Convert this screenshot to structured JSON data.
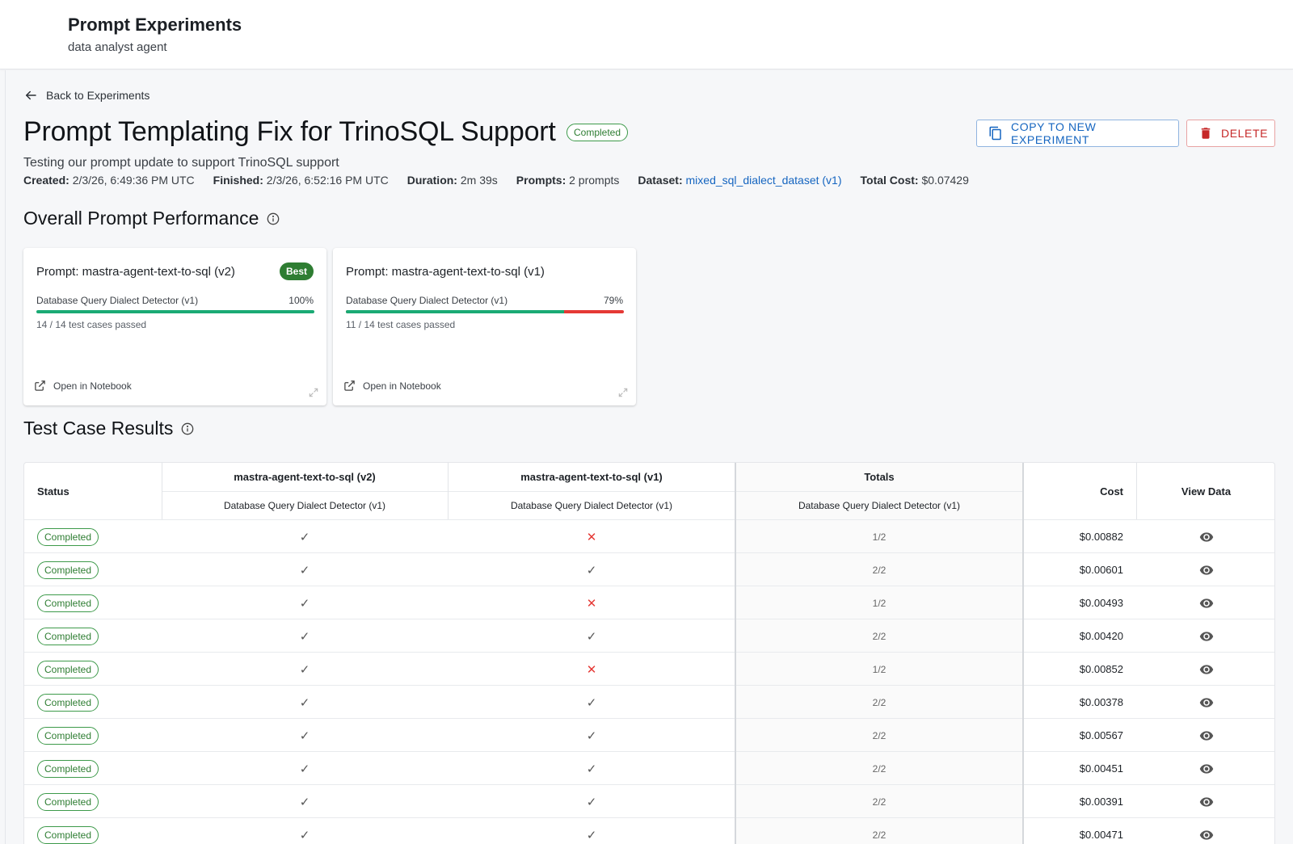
{
  "header": {
    "app_title": "Prompt Experiments",
    "app_subtitle": "data analyst agent"
  },
  "nav": {
    "back_label": "Back to Experiments"
  },
  "experiment": {
    "title": "Prompt Templating Fix for TrinoSQL Support",
    "status": "Completed",
    "description": "Testing our prompt update to support TrinoSQL support",
    "meta": {
      "created_label": "Created:",
      "created_value": "2/3/26, 6:49:36 PM UTC",
      "finished_label": "Finished:",
      "finished_value": "2/3/26, 6:52:16 PM UTC",
      "duration_label": "Duration:",
      "duration_value": "2m 39s",
      "prompts_label": "Prompts:",
      "prompts_value": "2 prompts",
      "dataset_label": "Dataset:",
      "dataset_value": "mixed_sql_dialect_dataset (v1)",
      "cost_label": "Total Cost:",
      "cost_value": "$0.07429"
    }
  },
  "actions": {
    "copy_label": "COPY TO NEW EXPERIMENT",
    "delete_label": "DELETE"
  },
  "performance": {
    "section_title": "Overall Prompt Performance",
    "cards": [
      {
        "title": "Prompt: mastra-agent-text-to-sql (v2)",
        "badge": "Best",
        "evaluator": "Database Query Dialect Detector (v1)",
        "percent": "100%",
        "pass_fraction": 1.0,
        "passed_text": "14 / 14 test cases passed",
        "notebook_label": "Open in Notebook"
      },
      {
        "title": "Prompt: mastra-agent-text-to-sql (v1)",
        "badge": "",
        "evaluator": "Database Query Dialect Detector (v1)",
        "percent": "79%",
        "pass_fraction": 0.786,
        "passed_text": "11 / 14 test cases passed",
        "notebook_label": "Open in Notebook"
      }
    ]
  },
  "results": {
    "section_title": "Test Case Results",
    "headers": {
      "status": "Status",
      "v2": "mastra-agent-text-to-sql (v2)",
      "v1": "mastra-agent-text-to-sql (v1)",
      "totals": "Totals",
      "cost": "Cost",
      "view": "View Data",
      "v2_sub": "Database Query Dialect Detector (v1)",
      "v1_sub": "Database Query Dialect Detector (v1)",
      "totals_sub": "Database Query Dialect Detector (v1)"
    },
    "rows": [
      {
        "status": "Completed",
        "v2": "✓",
        "v1": "✕",
        "total": "1/2",
        "cost": "$0.00882"
      },
      {
        "status": "Completed",
        "v2": "✓",
        "v1": "✓",
        "total": "2/2",
        "cost": "$0.00601"
      },
      {
        "status": "Completed",
        "v2": "✓",
        "v1": "✕",
        "total": "1/2",
        "cost": "$0.00493"
      },
      {
        "status": "Completed",
        "v2": "✓",
        "v1": "✓",
        "total": "2/2",
        "cost": "$0.00420"
      },
      {
        "status": "Completed",
        "v2": "✓",
        "v1": "✕",
        "total": "1/2",
        "cost": "$0.00852"
      },
      {
        "status": "Completed",
        "v2": "✓",
        "v1": "✓",
        "total": "2/2",
        "cost": "$0.00378"
      },
      {
        "status": "Completed",
        "v2": "✓",
        "v1": "✓",
        "total": "2/2",
        "cost": "$0.00567"
      },
      {
        "status": "Completed",
        "v2": "✓",
        "v1": "✓",
        "total": "2/2",
        "cost": "$0.00451"
      },
      {
        "status": "Completed",
        "v2": "✓",
        "v1": "✓",
        "total": "2/2",
        "cost": "$0.00391"
      },
      {
        "status": "Completed",
        "v2": "✓",
        "v1": "✓",
        "total": "2/2",
        "cost": "$0.00471"
      }
    ]
  },
  "colors": {
    "accent_blue": "#1565c0",
    "danger_red": "#c62828",
    "success_green": "#2e7d32",
    "bar_pass": "#1aaa74",
    "bar_fail": "#e53935"
  },
  "icons": {
    "back": "arrow-left-icon",
    "copy": "copy-icon",
    "delete": "trash-icon",
    "info": "info-icon",
    "notebook": "external-link-icon",
    "expand": "expand-icon",
    "view": "eye-icon"
  }
}
